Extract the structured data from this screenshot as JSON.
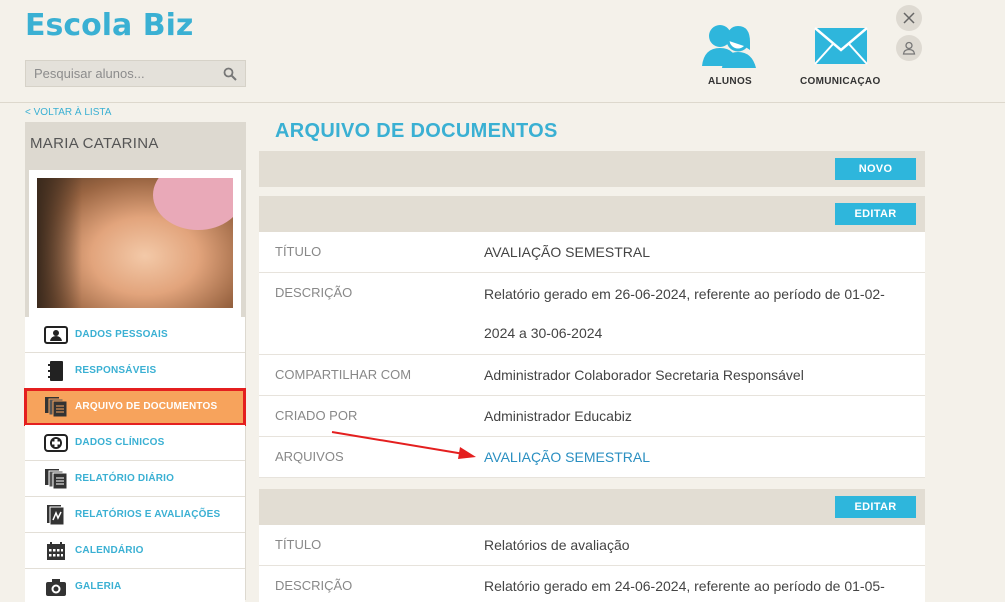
{
  "app": {
    "title": "Escola Biz"
  },
  "search": {
    "placeholder": "Pesquisar alunos..."
  },
  "topnav": {
    "alunos_label": "ALUNOS",
    "comunicacao_label": "COMUNICAÇAO"
  },
  "back_link": "< VOLTAR À LISTA",
  "student": {
    "name": "MARIA CATARINA"
  },
  "menu": {
    "items": [
      {
        "label": "DADOS PESSOAIS",
        "icon": "id-card-icon"
      },
      {
        "label": "RESPONSÁVEIS",
        "icon": "notebook-icon"
      },
      {
        "label": "ARQUIVO DE DOCUMENTOS",
        "icon": "documents-icon",
        "active": true
      },
      {
        "label": "DADOS CLÍNICOS",
        "icon": "medical-cross-icon"
      },
      {
        "label": "RELATÓRIO DIÁRIO",
        "icon": "report-icon"
      },
      {
        "label": "RELATÓRIOS E AVALIAÇÕES",
        "icon": "evaluation-icon"
      },
      {
        "label": "CALENDÁRIO",
        "icon": "calendar-icon"
      },
      {
        "label": "GALERIA",
        "icon": "camera-icon"
      }
    ]
  },
  "main": {
    "title": "ARQUIVO DE DOCUMENTOS",
    "new_button": "NOVO",
    "edit_button": "EDITAR",
    "documents": [
      {
        "fields": [
          {
            "key": "TÍTULO",
            "value": "AVALIAÇÃO SEMESTRAL"
          },
          {
            "key": "DESCRIÇÃO",
            "value": "Relatório gerado em 26-06-2024, referente ao período de 01-02-2024 a 30-06-2024"
          },
          {
            "key": "COMPARTILHAR COM",
            "value": "Administrador Colaborador Secretaria Responsável"
          },
          {
            "key": "CRIADO POR",
            "value": "Administrador Educabiz"
          },
          {
            "key": "ARQUIVOS",
            "value": "AVALIAÇÃO SEMESTRAL"
          }
        ]
      },
      {
        "fields": [
          {
            "key": "TÍTULO",
            "value": "Relatórios de avaliação"
          },
          {
            "key": "DESCRIÇÃO",
            "value": "Relatório gerado em 24-06-2024, referente ao período de 01-05-"
          }
        ]
      }
    ]
  },
  "colors": {
    "accent": "#3ab0d3",
    "button": "#2eb6dc",
    "active_item": "#f7a35c",
    "highlight_border": "#e41f1f",
    "annotation_arrow": "#e41f1f"
  }
}
